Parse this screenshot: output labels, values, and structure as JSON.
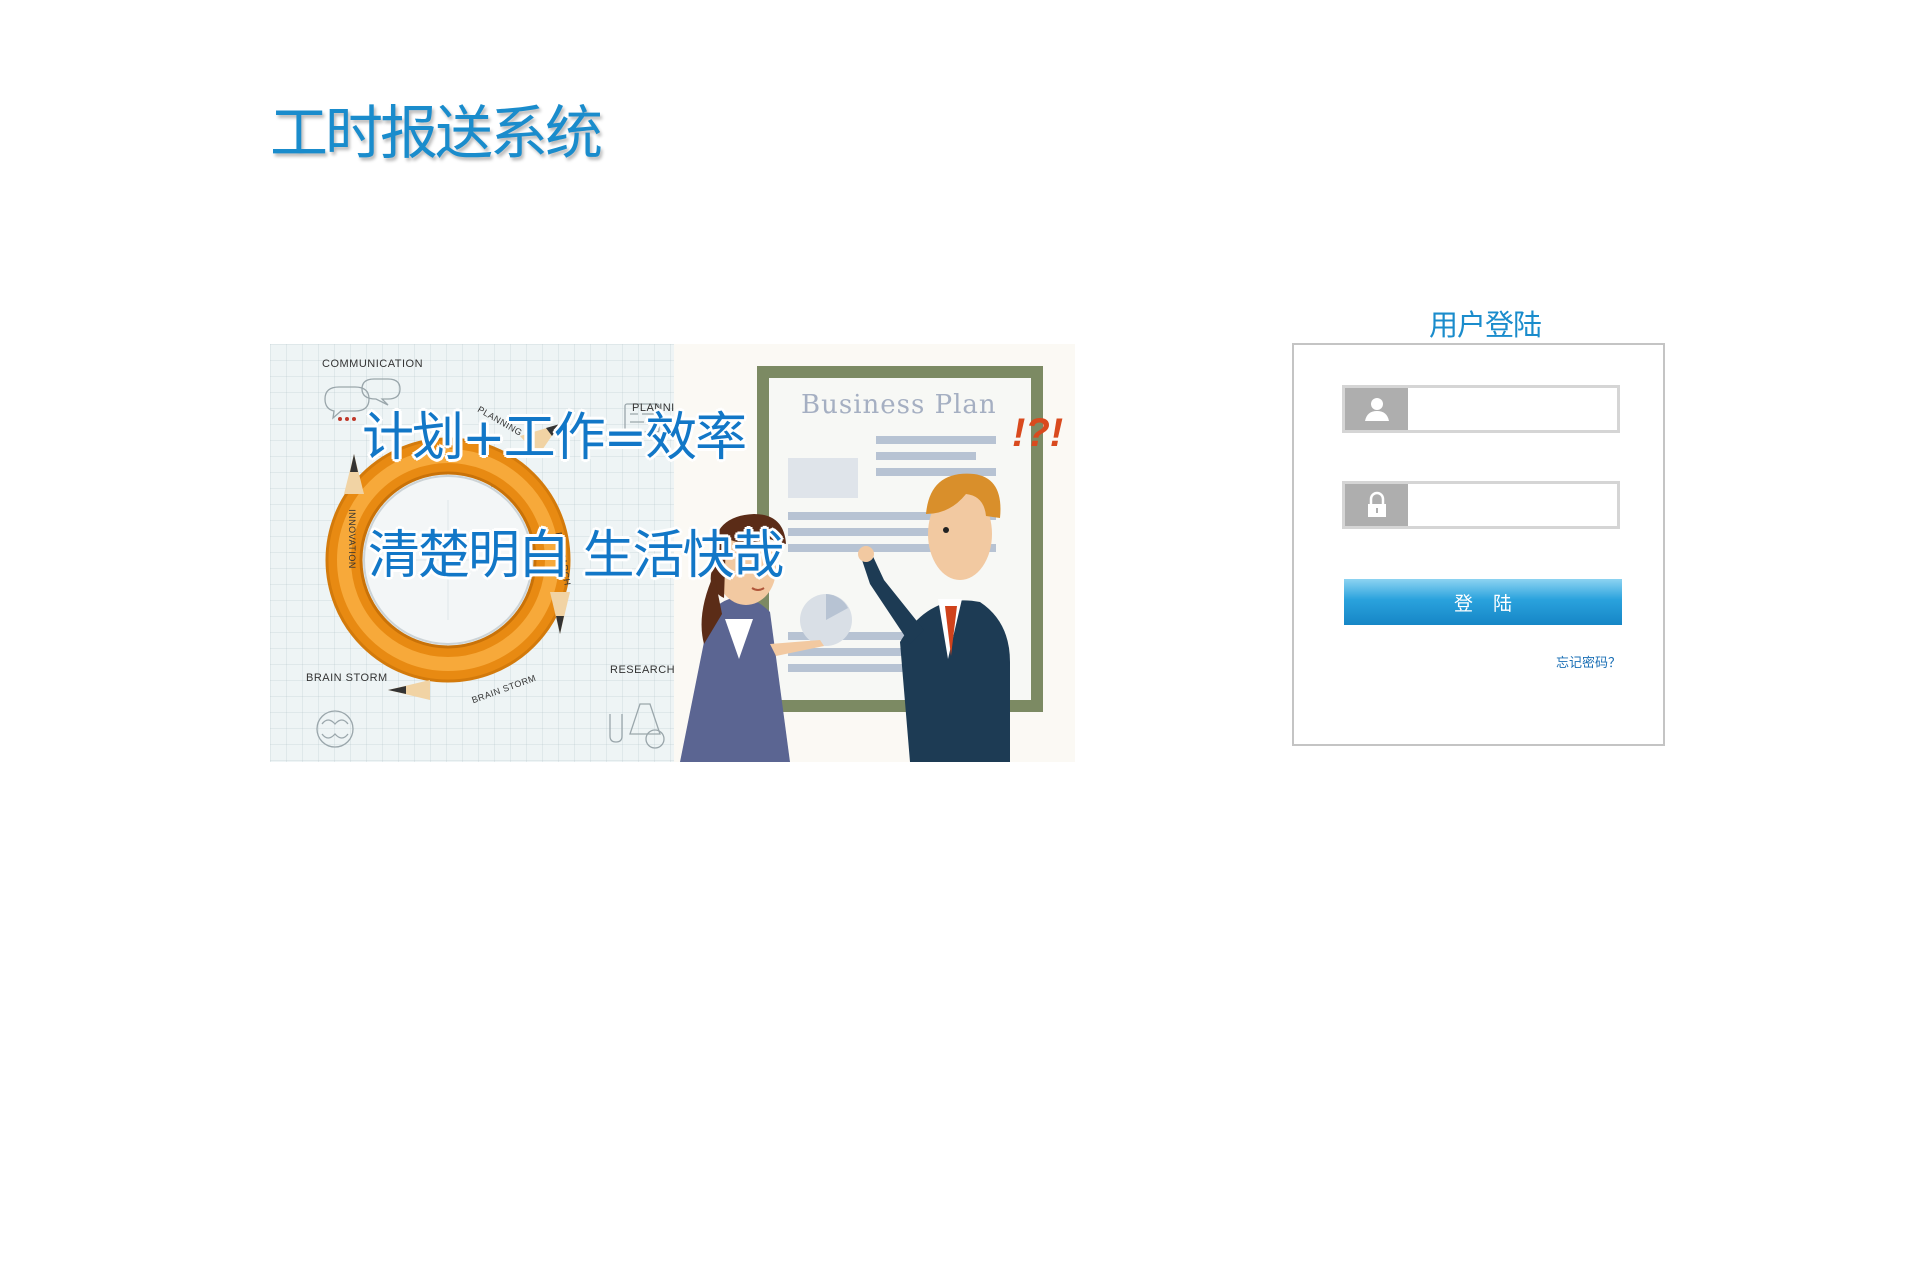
{
  "app": {
    "title": "工时报送系统"
  },
  "banner": {
    "slogan_line1": "计划+工作=效率",
    "slogan_line2": "清楚明白 生活快哉",
    "doc_title": "Business Plan",
    "labels": {
      "communication": "COMMUNICATION",
      "planning": "PLANNI",
      "planning_arc": "PLANNING",
      "research": "RESEARCH",
      "research_pencil": "RESEARCH",
      "brain_storm": "BRAIN STORM",
      "brain_storm_pencil": "BRAIN STORM",
      "innovation": "INNOVATION",
      "exclaim": "!?!"
    }
  },
  "login": {
    "heading": "用户登陆",
    "username_placeholder": "",
    "password_placeholder": "",
    "submit_label": "登陆",
    "forgot_label": "忘记密码？",
    "icons": {
      "username": "user-icon",
      "password": "lock-icon"
    }
  },
  "colors": {
    "brand": "#1a8ccc",
    "slogan": "#1277c7",
    "button_top": "#8dd3f2",
    "button_bottom": "#1686c6",
    "icon_bg": "#aeaeae"
  }
}
